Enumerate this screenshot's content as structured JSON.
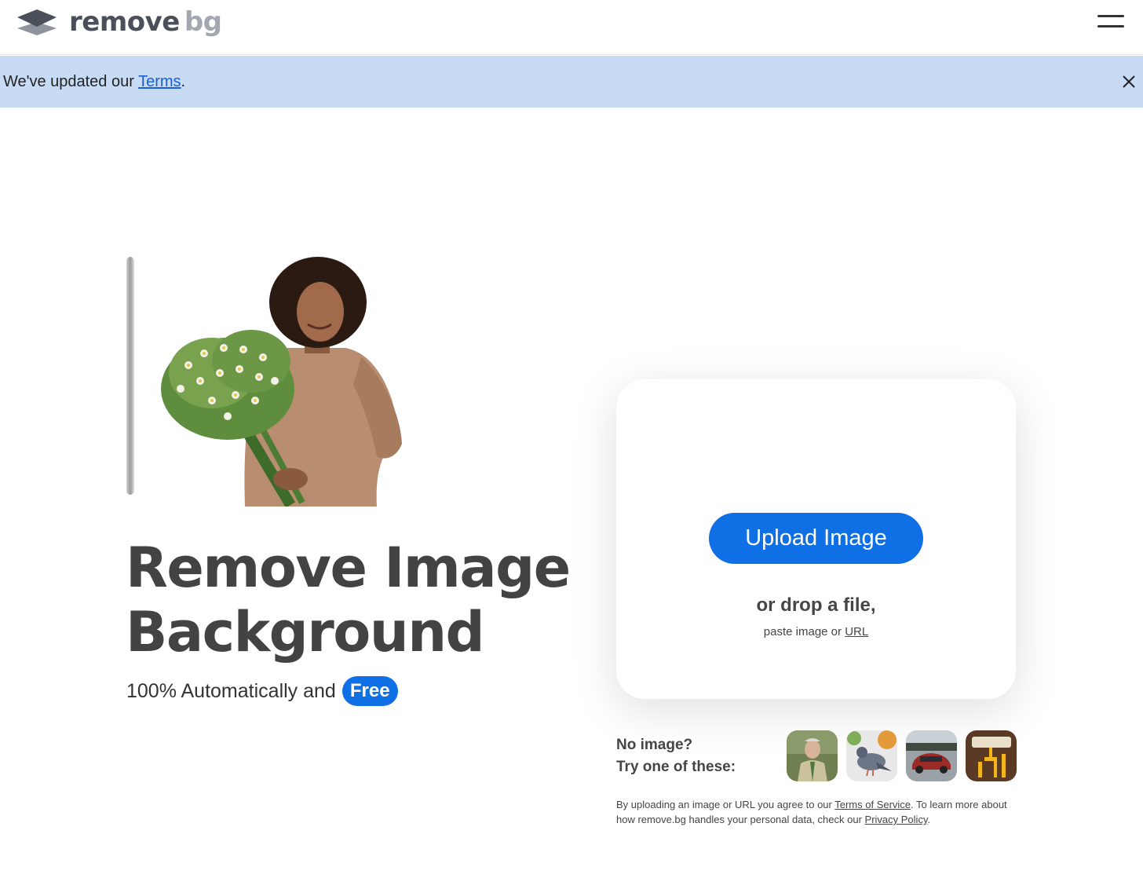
{
  "header": {
    "logo_main": "remove",
    "logo_accent": "bg",
    "menu_icon": "hamburger-menu-icon"
  },
  "banner": {
    "text_before": "We've updated our ",
    "link_text": "Terms",
    "text_after": ".",
    "close_icon": "close-icon"
  },
  "hero": {
    "title_line1": "Remove Image",
    "title_line2": "Background",
    "subtitle": "100% Automatically and",
    "badge": "Free"
  },
  "upload": {
    "button_label": "Upload Image",
    "drop_text": "or drop a file,",
    "paste_text": "paste image or ",
    "url_link": "URL"
  },
  "samples": {
    "line1": "No image?",
    "line2": "Try one of these:",
    "items": [
      "person-sample",
      "pigeon-sample",
      "car-sample",
      "tools-sample"
    ]
  },
  "legal": {
    "part1": "By uploading an image or URL you agree to our ",
    "tos_link": "Terms of Service",
    "part2": ". To learn more about how remove.bg handles your personal data, check our ",
    "privacy_link": "Privacy Policy",
    "part3": "."
  },
  "colors": {
    "accent": "#0f70e6",
    "banner_bg": "#c7dbf5",
    "heading": "#434343"
  }
}
